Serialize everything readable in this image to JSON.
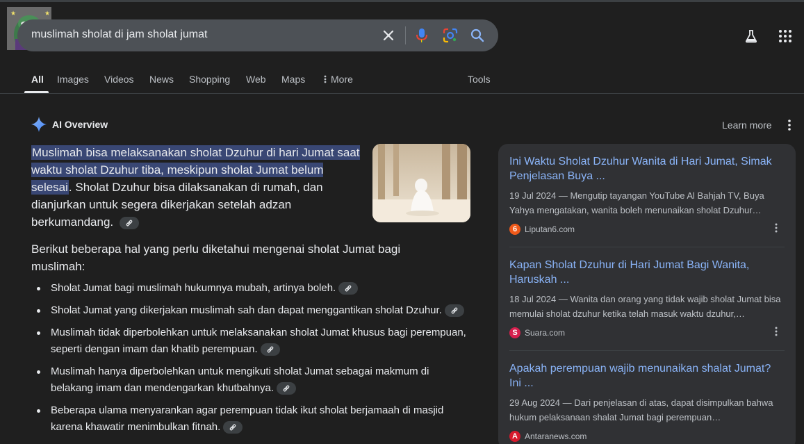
{
  "search": {
    "query": "muslimah sholat di jam sholat jumat"
  },
  "tabs": [
    {
      "label": "All"
    },
    {
      "label": "Images"
    },
    {
      "label": "Videos"
    },
    {
      "label": "News"
    },
    {
      "label": "Shopping"
    },
    {
      "label": "Web"
    },
    {
      "label": "Maps"
    },
    {
      "label": "More"
    }
  ],
  "tools_label": "Tools",
  "ai_overview": {
    "title": "AI Overview",
    "learn_more": "Learn more",
    "highlighted": "Muslimah bisa melaksanakan sholat Dzuhur di hari Jumat saat waktu sholat Dzuhur tiba, meskipun sholat Jumat be­lum selesai",
    "rest": ". Sholat Dzuhur bisa dilaksanakan di rumah, dan dianjurkan untuk segera dikerjakan setelah adzan berkumandang.",
    "intro": "Berikut beberapa hal yang perlu diketahui mengenai sholat Jumat bagi muslimah:",
    "bullets": [
      "Sholat Jumat bagi muslimah hukumnya mubah, artinya boleh.",
      "Sholat Jumat yang dikerjakan muslimah sah dan dapat menggantikan sholat Dzuhur.",
      "Muslimah tidak diperbolehkan untuk melaksanakan sholat Jumat khusus bagi perempuan, seperti dengan imam dan khatib perempuan.",
      "Muslimah hanya diperbolehkan untuk mengikuti sholat Jumat sebagai makmum di belakang imam dan mendengarkan khutbahnya.",
      "Beberapa ulama menyarankan agar perempuan tidak ikut sholat berjamaah di masjid karena khawatir menimbulkan fitnah."
    ]
  },
  "sources": [
    {
      "title": "Ini Waktu Sholat Dzuhur Wanita di Hari Jumat, Simak Penjelasan Buya ...",
      "snippet": "19 Jul 2024 — Mengutip tayangan YouTube Al Bahjah TV, Buya Yahya mengatakan, wanita boleh menunaikan sholat Dzuhur…",
      "site": "Liputan6.com",
      "favicon_letter": "6",
      "favicon_color": "#f05a1a"
    },
    {
      "title": "Kapan Sholat Dzuhur di Hari Jumat Bagi Wanita, Haruskah ...",
      "snippet": "18 Jul 2024 — Wanita dan orang yang tidak wajib sholat Jumat bisa memulai sholat dzuhur ketika telah masuk waktu dzuhur,…",
      "site": "Suara.com",
      "favicon_letter": "S",
      "favicon_color": "#d6204e"
    },
    {
      "title": "Apakah perempuan wajib menunaikan shalat Jumat? Ini ...",
      "snippet": "29 Aug 2024 — Dari penjelasan di atas, dapat disimpulkan bahwa hukum pelaksanaan shalat Jumat bagi perempuan…",
      "site": "Antaranews.com",
      "favicon_letter": "A",
      "favicon_color": "#d7192c"
    }
  ],
  "colors": {
    "background": "#1f1f1f",
    "link": "#8ab4f8",
    "highlight": "#394774",
    "panel": "#303134"
  }
}
